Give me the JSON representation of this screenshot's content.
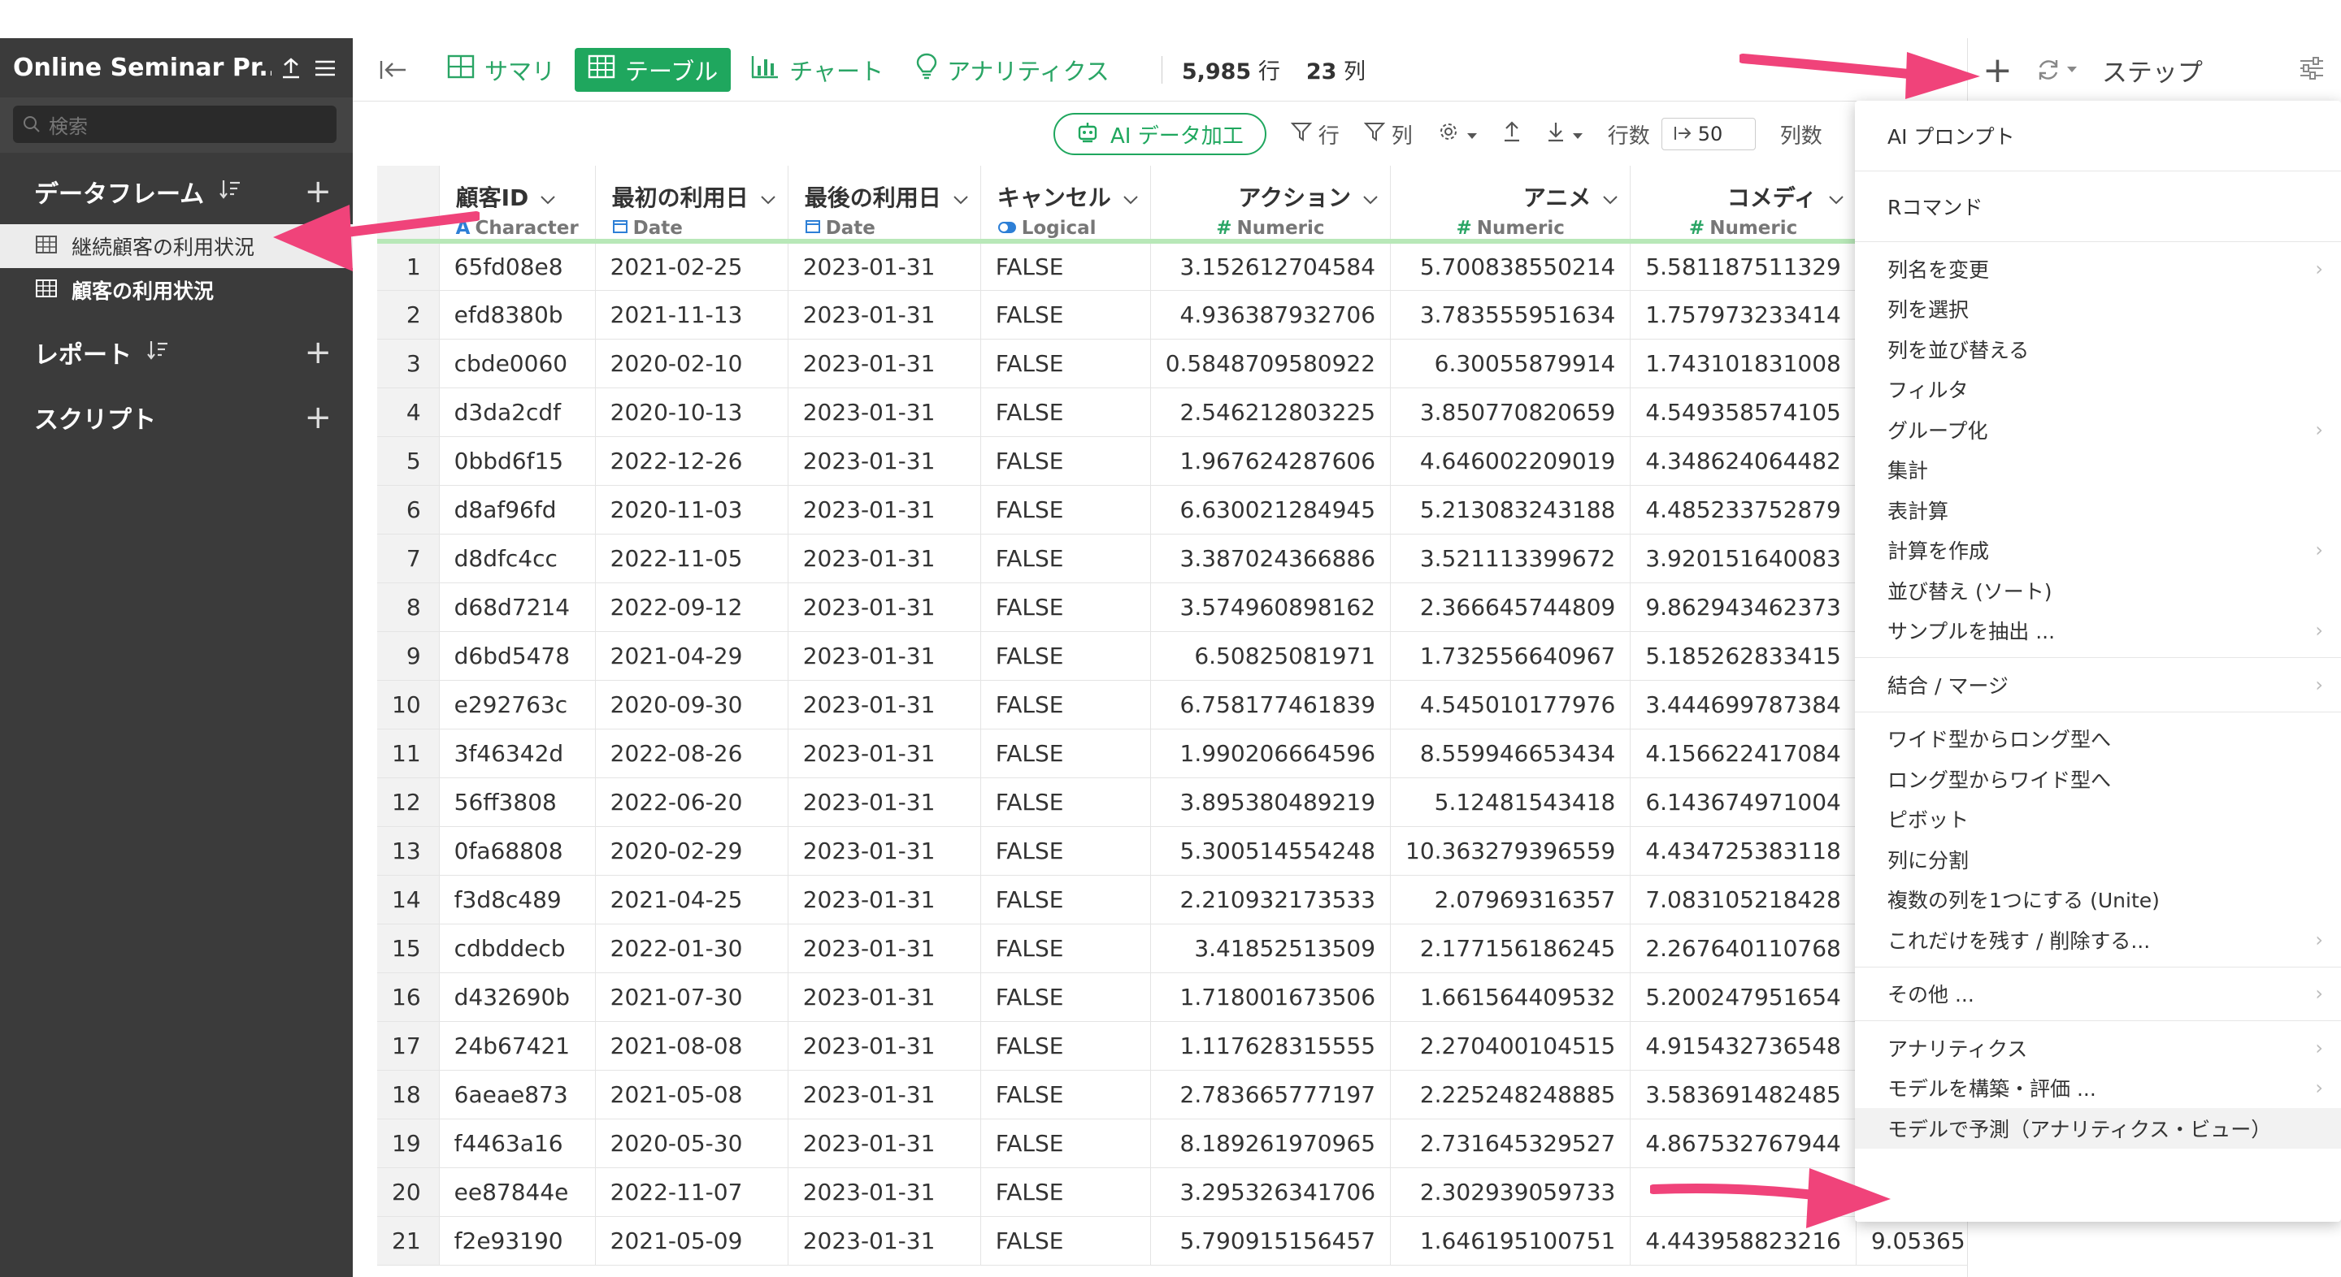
{
  "sidebar": {
    "project_title": "Online Seminar Pr...",
    "search_placeholder": "検索",
    "sections": {
      "dataframes": "データフレーム",
      "reports": "レポート",
      "scripts": "スクリプト"
    },
    "dataframes": [
      {
        "label": "継続顧客の利用状況",
        "active": true
      },
      {
        "label": "顧客の利用状況",
        "active": false
      }
    ]
  },
  "topbar": {
    "tabs": [
      "サマリ",
      "テーブル",
      "チャート",
      "アナリティクス"
    ],
    "active_tab": "テーブル",
    "row_count": "5,985",
    "row_unit": "行",
    "col_count": "23",
    "col_unit": "列"
  },
  "step_panel": {
    "title": "ステップ"
  },
  "toolbar": {
    "ai_button": "AI データ加工",
    "row_filter": "行",
    "col_filter": "列",
    "row_count_label": "行数",
    "row_count_value": "50",
    "col_count_label": "列数"
  },
  "table": {
    "columns": [
      {
        "name": "顧客ID",
        "type": "Character"
      },
      {
        "name": "最初の利用日",
        "type": "Date"
      },
      {
        "name": "最後の利用日",
        "type": "Date"
      },
      {
        "name": "キャンセル",
        "type": "Logical"
      },
      {
        "name": "アクション",
        "type": "Numeric"
      },
      {
        "name": "アニメ",
        "type": "Numeric"
      },
      {
        "name": "コメディ",
        "type": "Numeric"
      }
    ],
    "rows": [
      [
        "1",
        "65fd08e8",
        "2021-02-25",
        "2023-01-31",
        "FALSE",
        "3.152612704584",
        "5.700838550214",
        "5.581187511329",
        ""
      ],
      [
        "2",
        "efd8380b",
        "2021-11-13",
        "2023-01-31",
        "FALSE",
        "4.936387932706",
        "3.783555951634",
        "1.757973233414",
        ""
      ],
      [
        "3",
        "cbde0060",
        "2020-02-10",
        "2023-01-31",
        "FALSE",
        "0.5848709580922",
        "6.30055879914",
        "1.743101831008",
        ""
      ],
      [
        "4",
        "d3da2cdf",
        "2020-10-13",
        "2023-01-31",
        "FALSE",
        "2.546212803225",
        "3.850770820659",
        "4.549358574105",
        ""
      ],
      [
        "5",
        "0bbd6f15",
        "2022-12-26",
        "2023-01-31",
        "FALSE",
        "1.967624287606",
        "4.646002209019",
        "4.348624064482",
        ""
      ],
      [
        "6",
        "d8af96fd",
        "2020-11-03",
        "2023-01-31",
        "FALSE",
        "6.630021284945",
        "5.213083243188",
        "4.485233752879",
        ""
      ],
      [
        "7",
        "d8dfc4cc",
        "2022-11-05",
        "2023-01-31",
        "FALSE",
        "3.387024366886",
        "3.521113399672",
        "3.920151640083",
        ""
      ],
      [
        "8",
        "d68d7214",
        "2022-09-12",
        "2023-01-31",
        "FALSE",
        "3.574960898162",
        "2.366645744809",
        "9.862943462373",
        ""
      ],
      [
        "9",
        "d6bd5478",
        "2021-04-29",
        "2023-01-31",
        "FALSE",
        "6.50825081971",
        "1.732556640967",
        "5.185262833415",
        ""
      ],
      [
        "10",
        "e292763c",
        "2020-09-30",
        "2023-01-31",
        "FALSE",
        "6.758177461839",
        "4.545010177976",
        "3.444699787384",
        ""
      ],
      [
        "11",
        "3f46342d",
        "2022-08-26",
        "2023-01-31",
        "FALSE",
        "1.990206664596",
        "8.559946653434",
        "4.156622417084",
        ""
      ],
      [
        "12",
        "56ff3808",
        "2022-06-20",
        "2023-01-31",
        "FALSE",
        "3.895380489219",
        "5.12481543418",
        "6.143674971004",
        ""
      ],
      [
        "13",
        "0fa68808",
        "2020-02-29",
        "2023-01-31",
        "FALSE",
        "5.300514554248",
        "10.363279396559",
        "4.434725383118",
        ""
      ],
      [
        "14",
        "f3d8c489",
        "2021-04-25",
        "2023-01-31",
        "FALSE",
        "2.210932173533",
        "2.07969316357",
        "7.083105218428",
        ""
      ],
      [
        "15",
        "cdbddecb",
        "2022-01-30",
        "2023-01-31",
        "FALSE",
        "3.41852513509",
        "2.177156186245",
        "2.267640110768",
        ""
      ],
      [
        "16",
        "d432690b",
        "2021-07-30",
        "2023-01-31",
        "FALSE",
        "1.718001673506",
        "1.661564409532",
        "5.200247951654",
        ""
      ],
      [
        "17",
        "24b67421",
        "2021-08-08",
        "2023-01-31",
        "FALSE",
        "1.117628315555",
        "2.270400104515",
        "4.915432736548",
        ""
      ],
      [
        "18",
        "6aeae873",
        "2021-05-08",
        "2023-01-31",
        "FALSE",
        "2.783665777197",
        "2.225248248885",
        "3.583691482485",
        ""
      ],
      [
        "19",
        "f4463a16",
        "2020-05-30",
        "2023-01-31",
        "FALSE",
        "8.189261970965",
        "2.731645329527",
        "4.867532767944",
        ""
      ],
      [
        "20",
        "ee87844e",
        "2022-11-07",
        "2023-01-31",
        "FALSE",
        "3.295326341706",
        "2.302939059733",
        "",
        ""
      ],
      [
        "21",
        "f2e93190",
        "2021-05-09",
        "2023-01-31",
        "FALSE",
        "5.790915156457",
        "1.646195100751",
        "4.443958823216",
        "9.05365"
      ]
    ]
  },
  "menu": {
    "groups": [
      {
        "big": true,
        "items": [
          {
            "label": "AI プロンプト",
            "sub": false
          }
        ]
      },
      {
        "big": true,
        "items": [
          {
            "label": "Rコマンド",
            "sub": false
          }
        ]
      },
      {
        "big": false,
        "items": [
          {
            "label": "列名を変更",
            "sub": true
          },
          {
            "label": "列を選択",
            "sub": false
          },
          {
            "label": "列を並び替える",
            "sub": false
          },
          {
            "label": "フィルタ",
            "sub": false
          },
          {
            "label": "グループ化",
            "sub": true
          },
          {
            "label": "集計",
            "sub": false
          },
          {
            "label": "表計算",
            "sub": false
          },
          {
            "label": "計算を作成",
            "sub": true
          },
          {
            "label": "並び替え (ソート)",
            "sub": false
          },
          {
            "label": "サンプルを抽出 ...",
            "sub": true
          }
        ]
      },
      {
        "big": false,
        "items": [
          {
            "label": "結合 / マージ",
            "sub": true
          }
        ]
      },
      {
        "big": false,
        "items": [
          {
            "label": "ワイド型からロング型へ",
            "sub": false
          },
          {
            "label": "ロング型からワイド型へ",
            "sub": false
          },
          {
            "label": "ピボット",
            "sub": false
          },
          {
            "label": "列に分割",
            "sub": false
          },
          {
            "label": "複数の列を1つにする (Unite)",
            "sub": false
          },
          {
            "label": "これだけを残す / 削除する...",
            "sub": true
          }
        ]
      },
      {
        "big": false,
        "items": [
          {
            "label": "その他 ...",
            "sub": true
          }
        ]
      },
      {
        "big": false,
        "items": [
          {
            "label": "アナリティクス",
            "sub": true
          },
          {
            "label": "モデルを構築・評価 ...",
            "sub": true
          },
          {
            "label": "モデルで予測（アナリティクス・ビュー）",
            "sub": false,
            "highlight": true
          }
        ]
      }
    ]
  },
  "colors": {
    "brand_green": "#1fa75e",
    "sidebar_bg": "#3b3b3b",
    "arrow_pink": "#f0437a"
  }
}
